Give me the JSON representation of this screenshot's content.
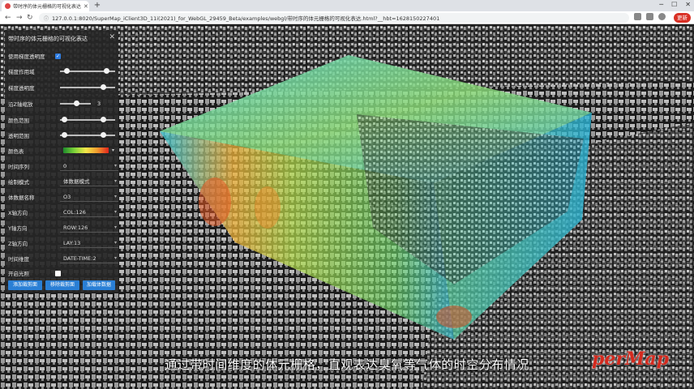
{
  "browser": {
    "tab_title": "带时序的体元栅格的可视化表达",
    "url": "127.0.0.1:8020/SuperMap_iClient3D_11i(2021)_for_WebGL_29459_Beta/examples/webgl/带时序的体元栅格的可视化表达.html?__hbt=1628150227401",
    "update_label": "更新"
  },
  "panel": {
    "title": "带时序的体元栅格的可视化表达",
    "use_scale_transparency": {
      "label": "使用梯度透明度",
      "checked": true
    },
    "gradient_threshold": {
      "label": "梯度作用域",
      "low": 0.12,
      "high": 0.85
    },
    "gradient_opacity": {
      "label": "梯度透明度",
      "value": 0.78
    },
    "z_scale": {
      "label": "沿Z轴缩放",
      "value": "3",
      "fill": 0.55
    },
    "color_range": {
      "label": "颜色范围",
      "low": 0.08,
      "high": 0.78
    },
    "opacity_range": {
      "label": "透明范围",
      "low": 0.08,
      "high": 0.78
    },
    "color_table": {
      "label": "颜色表"
    },
    "time_index": {
      "label": "时间序列",
      "value": "0"
    },
    "draw_mode": {
      "label": "绘制模式",
      "value": "体数据模式"
    },
    "dataset_name": {
      "label": "体数据名称",
      "value": "O3"
    },
    "x_dim": {
      "label": "X轴方向",
      "value": "COL:126"
    },
    "y_dim": {
      "label": "Y轴方向",
      "value": "ROW:126"
    },
    "z_dim": {
      "label": "Z轴方向",
      "value": "LAY:13"
    },
    "time_dim": {
      "label": "时间维度",
      "value": "DATE-TIME:2"
    },
    "lighting": {
      "label": "开启光照",
      "checked": false
    },
    "buttons": {
      "add_clip": "添加裁剪面",
      "remove_clip": "移除裁剪面",
      "load_voxel": "加载体数据"
    }
  },
  "subtitle": "通过带时间维度的体元栅格，直观表达臭氧等气体的时空分布情况",
  "logo_text": "perMap",
  "colors": {
    "panel_bg": "#262626",
    "button": "#2a7fd5",
    "update_button": "#d93025",
    "logo": "#d42a1e"
  }
}
